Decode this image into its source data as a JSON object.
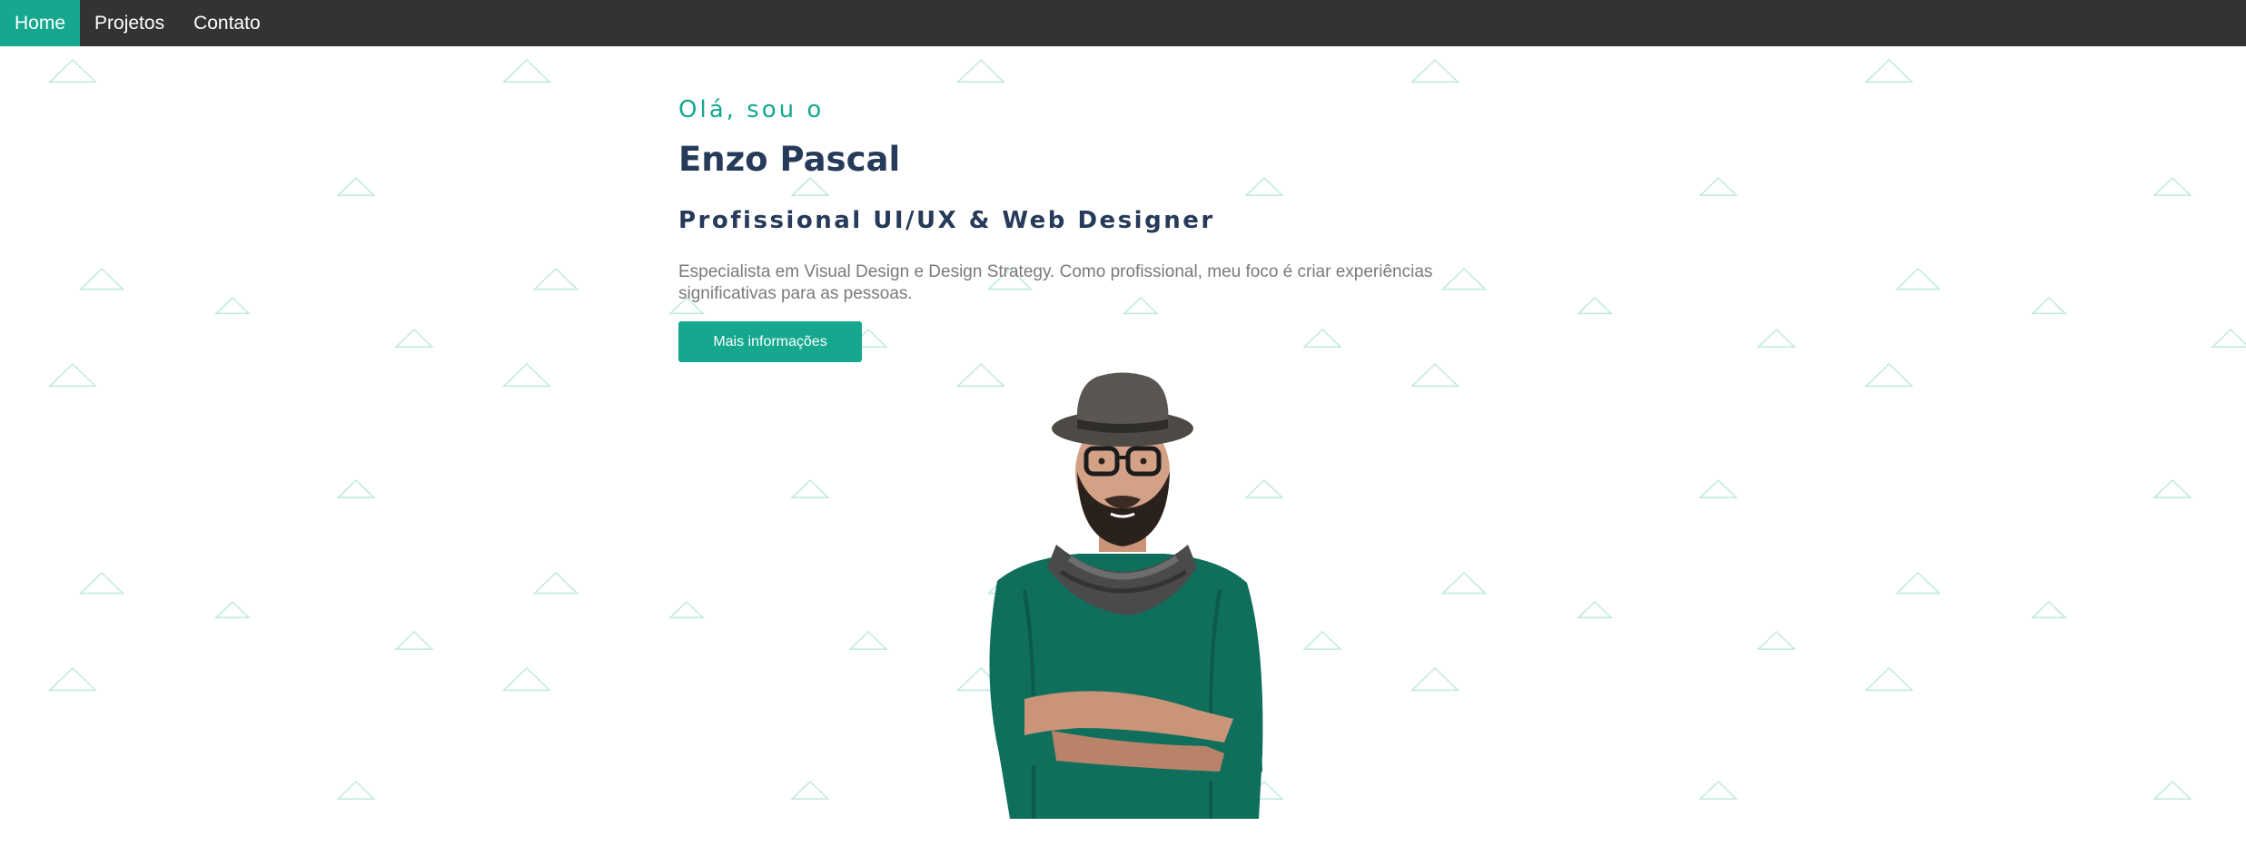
{
  "nav": {
    "items": [
      {
        "label": "Home",
        "active": true
      },
      {
        "label": "Projetos",
        "active": false
      },
      {
        "label": "Contato",
        "active": false
      }
    ]
  },
  "hero": {
    "greeting": "Olá, sou o",
    "name": "Enzo Pascal",
    "role": "Profissional UI/UX & Web Designer",
    "description": "Especialista em Visual Design e Design Strategy. Como profissional, meu foco é criar experiências significativas para as pessoas.",
    "cta_label": "Mais informações",
    "portrait_icon": "person-portrait"
  },
  "colors": {
    "accent": "#16a88f",
    "navbar": "#333333",
    "heading": "#263a5a",
    "body_text": "#7a7a7a",
    "pattern": "#bfe8e0"
  }
}
